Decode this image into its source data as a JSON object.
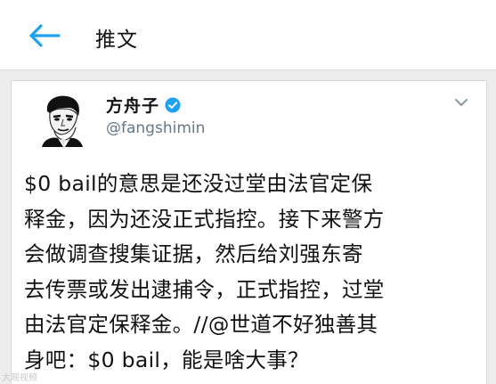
{
  "header": {
    "title": "推文"
  },
  "tweet": {
    "author_name": "方舟子",
    "author_handle": "@fangshimin",
    "text": "$0 bail的意思是还没过堂由法官定保\n释金，因为还没正式指控。接下来警方\n会做调查搜集证据，然后给刘强东寄\n去传票或发出逮捕令，正式指控，过堂\n由法官定保释金。//@世道不好独善其\n身吧：$0 bail，能是啥大事？"
  },
  "watermark": "大观视频",
  "colors": {
    "accent": "#1da1f2",
    "verified": "#1da1f2",
    "handle": "#657786"
  },
  "icons": {
    "back": "arrow-left-icon",
    "verified": "verified-badge-icon",
    "menu": "chevron-down-icon"
  }
}
